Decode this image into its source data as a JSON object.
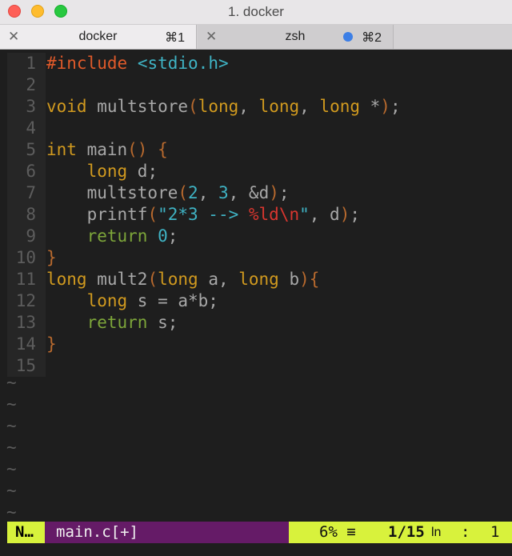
{
  "window": {
    "title": "1. docker"
  },
  "tabs": [
    {
      "label": "docker",
      "shortcut": "⌘1"
    },
    {
      "label": "zsh",
      "shortcut": "⌘2"
    }
  ],
  "editor": {
    "line_numbers": [
      "1",
      "2",
      "3",
      "4",
      "5",
      "6",
      "7",
      "8",
      "9",
      "10",
      "11",
      "12",
      "13",
      "14",
      "15"
    ],
    "lines": [
      "#include <stdio.h>",
      "",
      "void multstore(long, long, long *);",
      "",
      "int main() {",
      "    long d;",
      "    multstore(2, 3, &d);",
      "    printf(\"2*3 --> %ld\\n\", d);",
      "    return 0;",
      "}",
      "long mult2(long a, long b){",
      "    long s = a*b;",
      "    return s;",
      "}",
      ""
    ],
    "empty_marker": "~"
  },
  "statusline": {
    "mode": "N…",
    "filename": "main.c[+]",
    "percent": "6%",
    "percent_icon": "≡",
    "position": "1/15",
    "ln_label": "ln",
    "separator": ":",
    "column": "1"
  },
  "colors": {
    "mode_bg": "#d8f23c",
    "file_bg": "#651b67",
    "preprocessor": "#e05a2a",
    "type": "#d19a1f",
    "string": "#3fb3c4",
    "keyword": "#7da63a"
  }
}
